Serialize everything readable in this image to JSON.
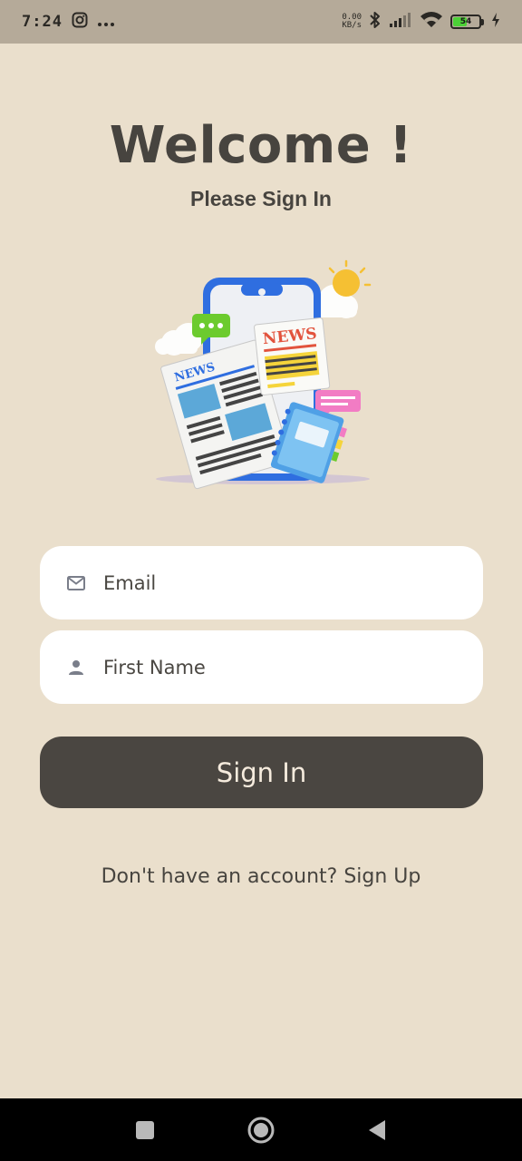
{
  "status_bar": {
    "time": "7:24",
    "speed_value": "0.00",
    "speed_unit": "KB/s",
    "battery_level": "54",
    "icons": [
      "instagram-icon",
      "more-dots-icon",
      "bluetooth-icon",
      "signal-icon",
      "wifi-icon",
      "battery-icon",
      "charging-icon"
    ]
  },
  "header": {
    "title": "Welcome !",
    "subtitle": "Please Sign In"
  },
  "illustration": {
    "front_news_label": "NEWS",
    "back_news_label": "NEWS"
  },
  "form": {
    "email": {
      "placeholder": "Email",
      "value": "",
      "icon": "mail-icon"
    },
    "first_name": {
      "placeholder": "First Name",
      "value": "",
      "icon": "person-icon"
    },
    "submit_label": "Sign In"
  },
  "footer": {
    "prompt": "Don't have an account? ",
    "link": "Sign Up"
  },
  "nav_bar": {
    "icons": [
      "recents-square-icon",
      "home-circle-icon",
      "back-triangle-icon"
    ]
  },
  "colors": {
    "background": "#EADFCC",
    "status_bar": "#B5AA99",
    "text": "#47443F",
    "button": "#4A4641",
    "button_text": "#F5EBDD"
  }
}
